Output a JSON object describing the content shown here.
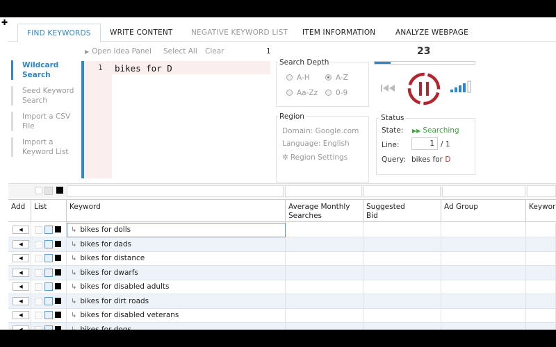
{
  "tabs": [
    {
      "label": "FIND KEYWORDS",
      "state": "active"
    },
    {
      "label": "WRITE CONTENT",
      "state": "normal"
    },
    {
      "label": "NEGATIVE KEYWORD LIST",
      "state": "disabled"
    },
    {
      "label": "ITEM INFORMATION",
      "state": "normal"
    },
    {
      "label": "ANALYZE WEBPAGE",
      "state": "normal"
    }
  ],
  "sidebar": {
    "items": [
      {
        "label": "Wildcard Search"
      },
      {
        "label": "Seed Keyword Search"
      },
      {
        "label": "Import a CSV File"
      },
      {
        "label": "Import a Keyword List"
      }
    ]
  },
  "toolbar": {
    "open_panel": "Open Idea Panel",
    "select_all": "Select All",
    "clear": "Clear",
    "count": "1"
  },
  "editor": {
    "line_number": "1",
    "text": "bikes for D"
  },
  "search_depth": {
    "title": "Search Depth",
    "options": [
      {
        "label": "A-H",
        "selected": false
      },
      {
        "label": "A-Z",
        "selected": true
      },
      {
        "label": "Aa-Zz",
        "selected": false
      },
      {
        "label": "0-9",
        "selected": false
      }
    ]
  },
  "region": {
    "title": "Region",
    "domain": "Domain: Google.com",
    "language": "Language: English",
    "settings": "Region Settings"
  },
  "search": {
    "counter": "23",
    "progress": 0.16
  },
  "status": {
    "title": "Status",
    "state_label": "State:",
    "state_value": "Searching",
    "line_label": "Line:",
    "line_current": "1",
    "line_total": "/ 1",
    "query_label": "Query:",
    "query_prefix": "bikes for ",
    "query_letter": "D"
  },
  "colors": {
    "accent": "#2f86c8",
    "pause": "#b5252f",
    "searching": "#3aa63a",
    "query_letter": "#c0392b"
  },
  "grid": {
    "headers": {
      "add": "Add",
      "list": "List",
      "keyword": "Keyword",
      "avg1": "Average Monthly",
      "avg2": "Searches",
      "bid1": "Suggested",
      "bid2": "Bid",
      "adgroup": "Ad Group",
      "keyword2": "Keywor"
    },
    "rows": [
      "bikes for dolls",
      "bikes for dads",
      "bikes for distance",
      "bikes for dwarfs",
      "bikes for disabled adults",
      "bikes for dirt roads",
      "bikes for disabled veterans",
      "bikes for dogs"
    ]
  }
}
